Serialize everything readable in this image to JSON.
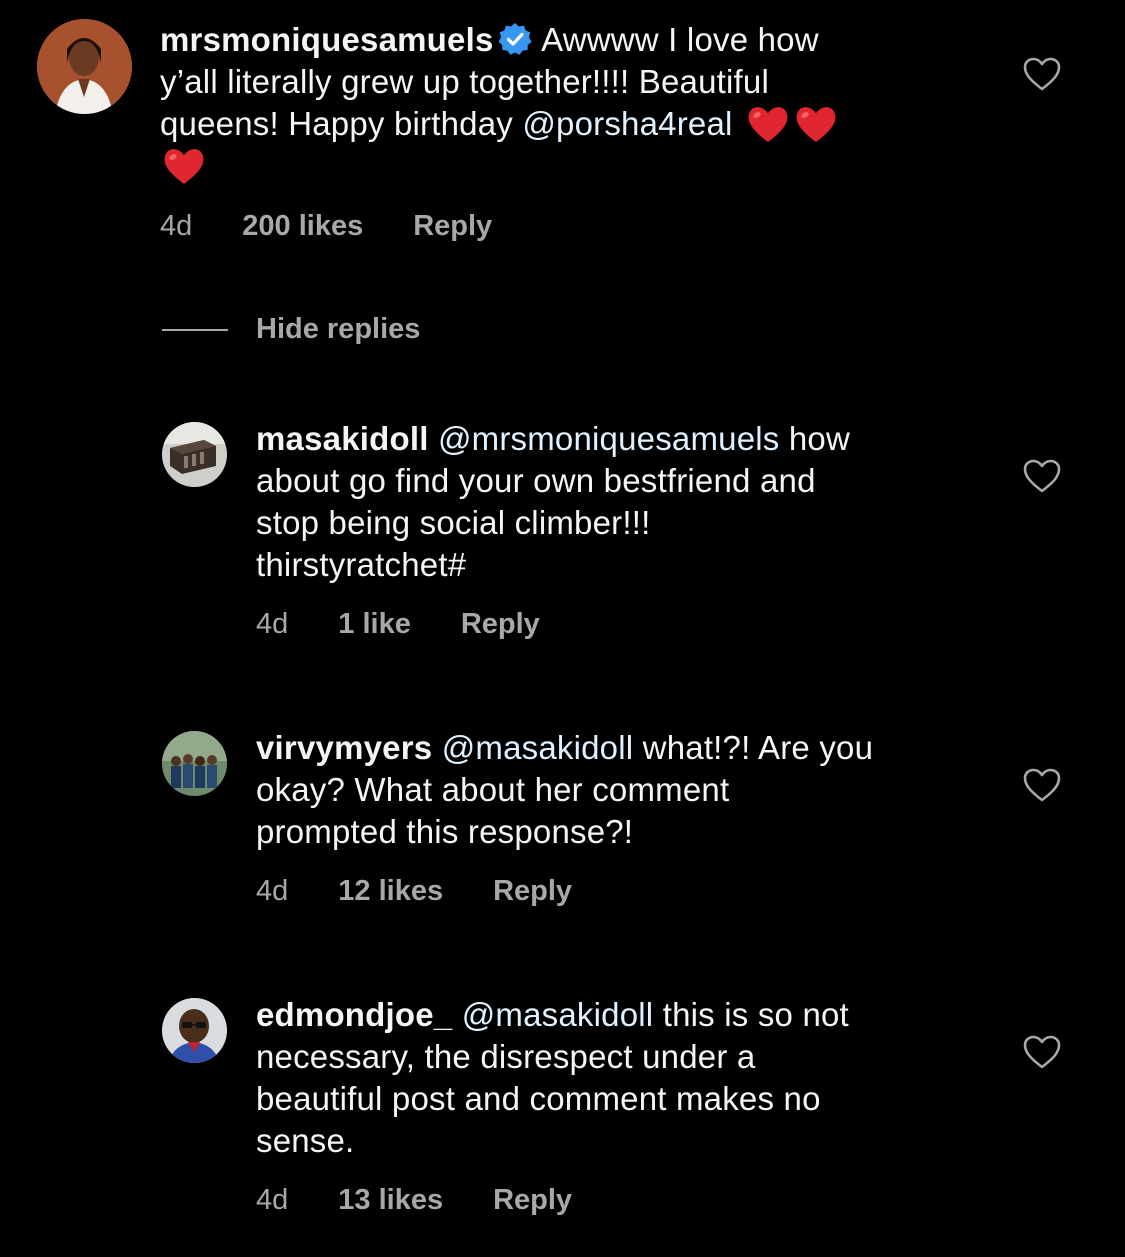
{
  "colors": {
    "background": "#000000",
    "text_primary": "#f5f5f5",
    "text_secondary": "#a8a8a8",
    "mention": "#e0f1ff",
    "verified": "#3897f0",
    "heart_emoji": "#e0262f"
  },
  "main_comment": {
    "username": "mrsmoniquesamuels",
    "verified": true,
    "text_line_1": "Awwww I love how",
    "text_line_2": "y’all literally grew up together!!!! Beautiful",
    "text_line_3_pre": "queens! Happy birthday ",
    "mention": "@porsha4real",
    "emoji": [
      "red-heart",
      "red-heart",
      "red-heart"
    ],
    "time": "4d",
    "likes": "200 likes",
    "reply_label": "Reply",
    "like_icon": "heart-outline-icon"
  },
  "hide_replies_label": "Hide replies",
  "replies": [
    {
      "username": "masakidoll",
      "mention": "@mrsmoniquesamuels",
      "line_1_rest": " how",
      "line_2": "about go find your own bestfriend and",
      "line_3": "stop being social climber!!!",
      "line_4": "thirstyratchet#",
      "time": "4d",
      "likes": "1 like",
      "reply_label": "Reply"
    },
    {
      "username": "virvymyers",
      "mention": "@masakidoll",
      "line_1_rest": " what!?! Are you",
      "line_2": "okay? What about her comment",
      "line_3": "prompted this response?!",
      "time": "4d",
      "likes": "12 likes",
      "reply_label": "Reply"
    },
    {
      "username": "edmondjoe_",
      "mention": "@masakidoll",
      "line_1_rest": " this is so not",
      "line_2": "necessary, the disrespect under a",
      "line_3": "beautiful post and comment makes no",
      "line_4": "sense.",
      "time": "4d",
      "likes": "13 likes",
      "reply_label": "Reply"
    }
  ]
}
